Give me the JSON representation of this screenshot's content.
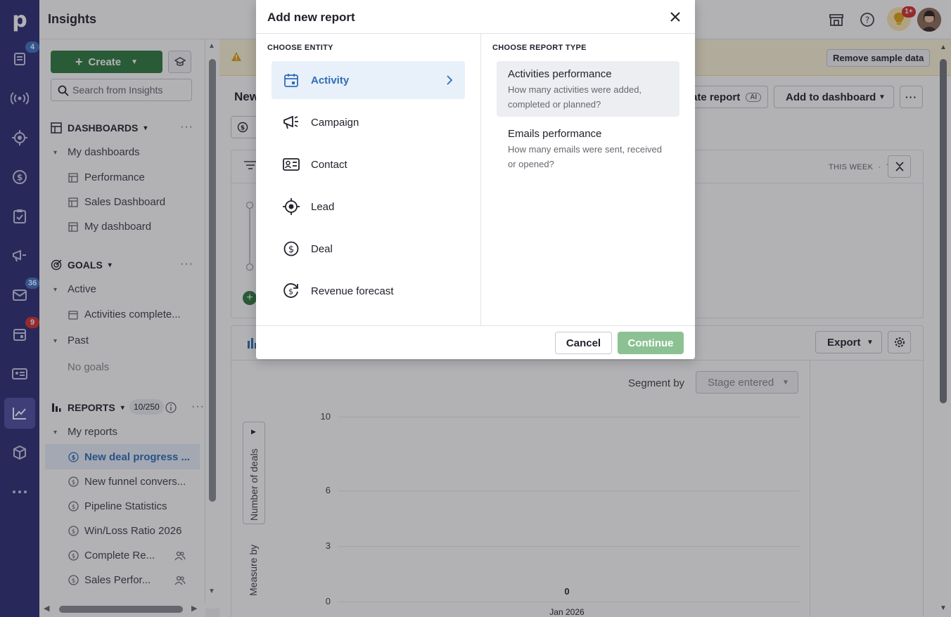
{
  "app": {
    "title": "Insights"
  },
  "rail": {
    "logo": "p",
    "items": [
      {
        "name": "leads-icon",
        "badge": "4"
      },
      {
        "name": "radio-icon",
        "badge": ""
      },
      {
        "name": "target-icon",
        "badge": ""
      },
      {
        "name": "deals-icon",
        "badge": ""
      },
      {
        "name": "tasks-icon",
        "badge": ""
      },
      {
        "name": "campaigns-icon",
        "badge": ""
      },
      {
        "name": "mail-icon",
        "badge": "36"
      },
      {
        "name": "calendar-icon",
        "badge": "9"
      },
      {
        "name": "contacts-icon",
        "badge": ""
      },
      {
        "name": "insights-icon",
        "badge": ""
      },
      {
        "name": "products-icon",
        "badge": ""
      },
      {
        "name": "more-icon",
        "badge": ""
      }
    ],
    "badge_colors": {
      "blue": "#3c71c7",
      "red": "#d42e2e"
    }
  },
  "topbar": {
    "bulb_badge": "1+"
  },
  "sidebar": {
    "create_label": "Create",
    "search_placeholder": "Search from Insights",
    "dashboards": {
      "title": "DASHBOARDS",
      "group": "My dashboards",
      "items": [
        "Performance",
        "Sales Dashboard",
        "My dashboard"
      ]
    },
    "goals": {
      "title": "GOALS",
      "active_group": "Active",
      "active_items": [
        "Activities complete..."
      ],
      "past_group": "Past",
      "past_empty": "No goals"
    },
    "reports": {
      "title": "REPORTS",
      "count": "10/250",
      "group": "My reports",
      "items": [
        "New deal progress ...",
        "New funnel convers...",
        "Pipeline Statistics",
        "Win/Loss Ratio 2026",
        "Complete Re...",
        "Sales Perfor..."
      ]
    }
  },
  "main": {
    "banner_button": "Remove sample data",
    "report_title": "New",
    "create_report_label": "ate report",
    "ai_tag": "AI",
    "add_dashboard_label": "Add to dashboard",
    "filter_period": "THIS WEEK",
    "filter_dot": "·",
    "filter_count": "7",
    "export_label": "Export",
    "segment_label": "Segment by",
    "segment_value": "Stage entered",
    "measure_label": "Measure by",
    "measure_value": "Number of deals"
  },
  "chart_data": {
    "type": "bar",
    "categories": [
      "Jan 2026"
    ],
    "values": [
      0
    ],
    "data_labels": [
      "0"
    ],
    "y_ticks": [
      "10",
      "6",
      "3",
      "0"
    ],
    "ylim": [
      0,
      10
    ],
    "xlabel": "",
    "ylabel": ""
  },
  "modal": {
    "title": "Add new report",
    "entity_heading": "CHOOSE ENTITY",
    "type_heading": "CHOOSE REPORT TYPE",
    "entities": [
      "Activity",
      "Campaign",
      "Contact",
      "Lead",
      "Deal",
      "Revenue forecast"
    ],
    "report_types": [
      {
        "title": "Activities performance",
        "desc": "How many activities were added, completed or planned?"
      },
      {
        "title": "Emails performance",
        "desc": "How many emails were sent, received or opened?"
      }
    ],
    "cancel_label": "Cancel",
    "continue_label": "Continue"
  },
  "colors": {
    "rail": "#2b2d73",
    "accent_blue": "#2f6db5",
    "create_green": "#2f7a3e",
    "continue_disabled": "#8cc293"
  }
}
